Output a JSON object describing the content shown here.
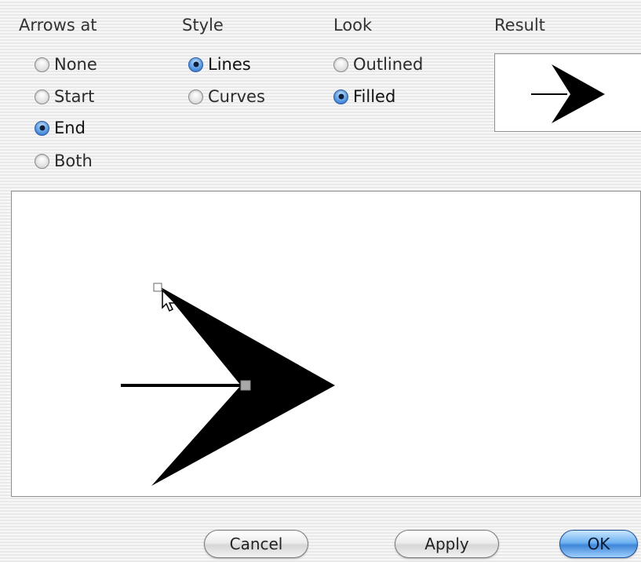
{
  "headers": {
    "arrows_at": "Arrows at",
    "style": "Style",
    "look": "Look",
    "result": "Result"
  },
  "arrows_at": {
    "options": [
      "None",
      "Start",
      "End",
      "Both"
    ],
    "selected": "End"
  },
  "style": {
    "options": [
      "Lines",
      "Curves"
    ],
    "selected": "Lines"
  },
  "look": {
    "options": [
      "Outlined",
      "Filled"
    ],
    "selected": "Filled"
  },
  "buttons": {
    "cancel": "Cancel",
    "apply": "Apply",
    "ok": "OK"
  },
  "icons": {
    "radio_selected": "radio-selected-icon",
    "radio_unselected": "radio-unselected-icon",
    "cursor": "arrow-cursor-icon"
  },
  "colors": {
    "accent_blue": "#3f86d8",
    "arrow_fill": "#000000",
    "handle": "#a8a8a8"
  }
}
